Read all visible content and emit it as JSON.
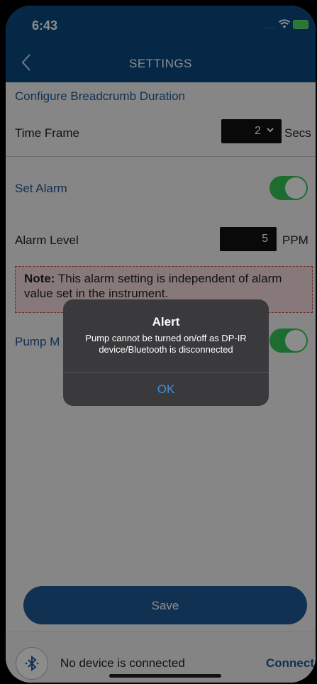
{
  "status_bar": {
    "time": "6:43",
    "signal": "....."
  },
  "nav": {
    "title": "SETTINGS"
  },
  "breadcrumb": {
    "header": "Configure Breadcrumb Duration",
    "time_frame_label": "Time Frame",
    "time_frame_value": "2",
    "time_frame_unit": "Secs"
  },
  "alarm": {
    "set_alarm_label": "Set Alarm",
    "set_alarm_on": true,
    "level_label": "Alarm Level",
    "level_value": "5",
    "level_unit": "PPM",
    "note_bold": "Note:",
    "note_text": " This alarm setting is independent of alarm value set in the instrument."
  },
  "pump": {
    "label": "Pump M",
    "on": true
  },
  "save_label": "Save",
  "footer": {
    "device_status": "No device is connected",
    "connect_label": "Connect"
  },
  "alert": {
    "title": "Alert",
    "message": "Pump cannot be turned on/off as DP-IR device/Bluetooth is disconnected",
    "ok_label": "OK"
  },
  "colors": {
    "nav_bg": "#0c4a82",
    "accent": "#1f5a97",
    "toggle_on": "#35c759",
    "note_bg": "#f6dcdc",
    "note_border": "#c0504d"
  }
}
